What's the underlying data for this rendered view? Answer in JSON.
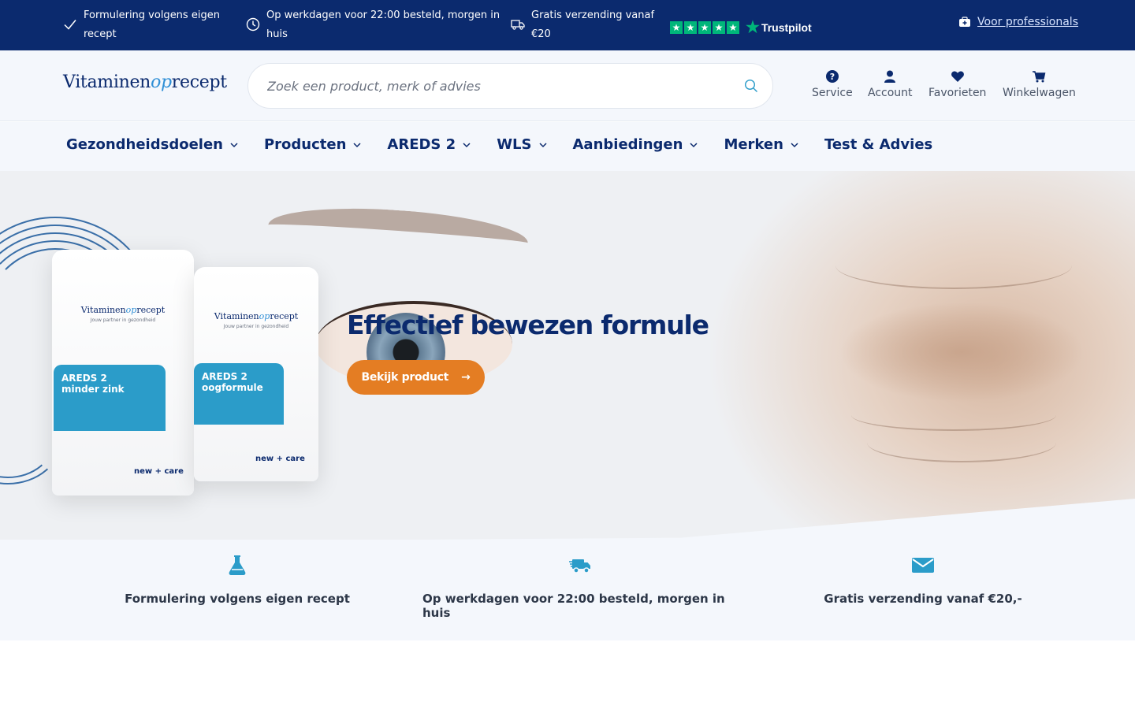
{
  "topbar": {
    "usps": [
      {
        "icon": "check-icon",
        "text": "Formulering volgens eigen recept"
      },
      {
        "icon": "clock-icon",
        "text": "Op werkdagen voor 22:00 besteld, morgen in huis"
      },
      {
        "icon": "truck-icon",
        "text": "Gratis verzending vanaf €20"
      }
    ],
    "trustpilot": {
      "stars": 5,
      "label": "Trustpilot",
      "color": "#00b67a"
    },
    "professionals_link": "Voor professionals"
  },
  "header": {
    "logo": {
      "part1": "Vitaminen",
      "part2": "op",
      "part3": "recept"
    },
    "search": {
      "placeholder": "Zoek een product, merk of advies",
      "value": ""
    },
    "nav": [
      {
        "icon": "question-circle-icon",
        "label": "Service"
      },
      {
        "icon": "user-icon",
        "label": "Account"
      },
      {
        "icon": "heart-icon",
        "label": "Favorieten"
      },
      {
        "icon": "cart-icon",
        "label": "Winkelwagen"
      }
    ]
  },
  "mainnav": {
    "items": [
      {
        "label": "Gezondheidsdoelen",
        "dropdown": true
      },
      {
        "label": "Producten",
        "dropdown": true
      },
      {
        "label": "AREDS 2",
        "dropdown": true
      },
      {
        "label": "WLS",
        "dropdown": true
      },
      {
        "label": "Aanbiedingen",
        "dropdown": true
      },
      {
        "label": "Merken",
        "dropdown": true
      },
      {
        "label": "Test & Advies",
        "dropdown": false
      }
    ]
  },
  "hero": {
    "title": "Effectief bewezen formule",
    "button": "Bekijk product",
    "products": [
      {
        "brand1": "Vitaminen",
        "brand2": "op",
        "brand3": "recept",
        "tagline": "Jouw partner in gezondheid",
        "name_line1": "AREDS 2",
        "name_line2": "minder zink",
        "care": "new + care"
      },
      {
        "brand1": "Vitaminen",
        "brand2": "op",
        "brand3": "recept",
        "tagline": "Jouw partner in gezondheid",
        "name_line1": "AREDS 2",
        "name_line2": "oogformule",
        "care": "new + care"
      }
    ]
  },
  "usp_band": {
    "items": [
      {
        "icon": "flask-icon",
        "label": "Formulering volgens eigen recept"
      },
      {
        "icon": "delivery-truck-icon",
        "label": "Op werkdagen voor 22:00 besteld, morgen in huis"
      },
      {
        "icon": "envelope-icon",
        "label": "Gratis verzending vanaf €20,-"
      }
    ]
  },
  "colors": {
    "brand_navy": "#0b2a6e",
    "accent_orange": "#e47d23",
    "icon_teal": "#2b9cc9",
    "light_bg": "#f4f7fc"
  }
}
